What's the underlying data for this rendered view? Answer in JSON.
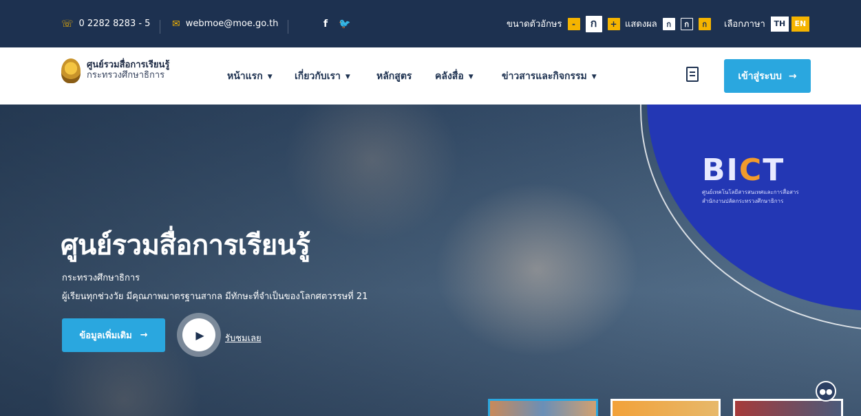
{
  "topbar": {
    "phone": "0 2282 8283 - 5",
    "email": "webmoe@moe.go.th",
    "social": {
      "facebook": "f",
      "twitter": "🐦"
    },
    "font_size_label": "ขนาดตัวอักษร",
    "font_size_options": [
      "-",
      "ก",
      "+"
    ],
    "display_label": "แสดงผล",
    "display_options": [
      "ก",
      "ก",
      "ก"
    ],
    "language_label": "เลือกภาษา",
    "languages": [
      "TH",
      "EN"
    ]
  },
  "nav": {
    "logo_title": "ศูนย์รวมสื่อการเรียนรู้",
    "logo_subtitle": "กระทรวงศึกษาธิการ",
    "items": [
      {
        "label": "หน้าแรก",
        "has_dropdown": true
      },
      {
        "label": "เกี่ยวกับเรา",
        "has_dropdown": true
      },
      {
        "label": "หลักสูตร",
        "has_dropdown": false
      },
      {
        "label": "คลังสื่อ",
        "has_dropdown": true
      },
      {
        "label": "ข่าวสารและกิจกรรม",
        "has_dropdown": true
      }
    ],
    "login_label": "เข้าสู่ระบบ",
    "arrow": "→",
    "chevron": "⌄"
  },
  "hero": {
    "title": "ศูนย์รวมสื่อการเรียนรู้",
    "subtitle": "กระทรวงศึกษาธิการ",
    "tagline": "ผู้เรียนทุกช่วงวัย มีคุณภาพมาตรฐานสากล มีทักษะที่จำเป็นของโลกศตวรรษที่ 21",
    "more_button": "ข้อมูลเพิ่มเติม",
    "watch_label": "รับชมเลย",
    "arrow": "→",
    "bict_logo": "BICT",
    "bict_line1": "ศูนย์เทคโนโลยีสารสนเทศและการสื่อสาร",
    "bict_line2": "สำนักงานปลัดกระทรวงศึกษาธิการ"
  },
  "colors": {
    "navy": "#1d3150",
    "accent_blue": "#2aa7df",
    "yellow": "#f5b400",
    "bict_blue": "#2337b4"
  },
  "icons": [
    "phone-icon",
    "email-icon",
    "facebook-icon",
    "twitter-icon",
    "book-icon",
    "arrow-right-icon",
    "play-icon",
    "chatbot-icon",
    "chevron-down-icon"
  ]
}
